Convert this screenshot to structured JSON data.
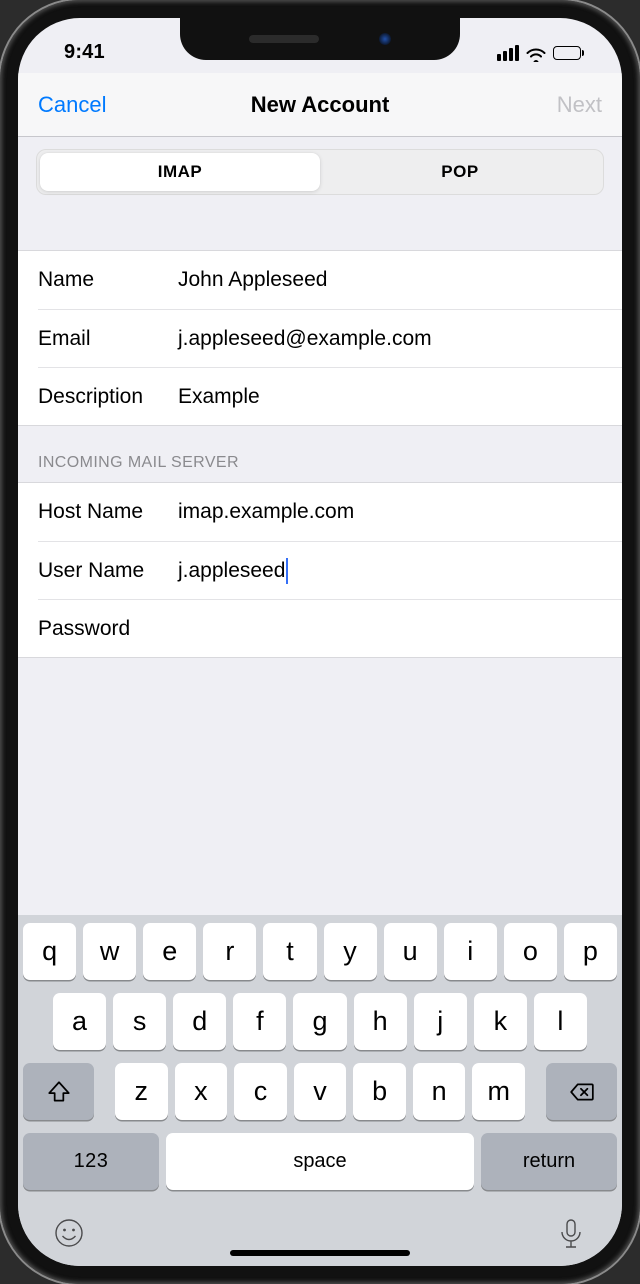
{
  "statusbar": {
    "time": "9:41"
  },
  "navbar": {
    "cancel": "Cancel",
    "title": "New Account",
    "next": "Next"
  },
  "segmented": {
    "imap": "IMAP",
    "pop": "POP"
  },
  "fields": {
    "name": {
      "label": "Name",
      "value": "John Appleseed"
    },
    "email": {
      "label": "Email",
      "value": "j.appleseed@example.com"
    },
    "description": {
      "label": "Description",
      "value": "Example"
    }
  },
  "incoming": {
    "header": "INCOMING MAIL SERVER",
    "host": {
      "label": "Host Name",
      "value": "imap.example.com"
    },
    "user": {
      "label": "User Name",
      "value": "j.appleseed"
    },
    "password": {
      "label": "Password",
      "value": ""
    }
  },
  "keyboard": {
    "row1": [
      "q",
      "w",
      "e",
      "r",
      "t",
      "y",
      "u",
      "i",
      "o",
      "p"
    ],
    "row2": [
      "a",
      "s",
      "d",
      "f",
      "g",
      "h",
      "j",
      "k",
      "l"
    ],
    "row3": [
      "z",
      "x",
      "c",
      "v",
      "b",
      "n",
      "m"
    ],
    "numKey": "123",
    "space": "space",
    "return": "return"
  }
}
